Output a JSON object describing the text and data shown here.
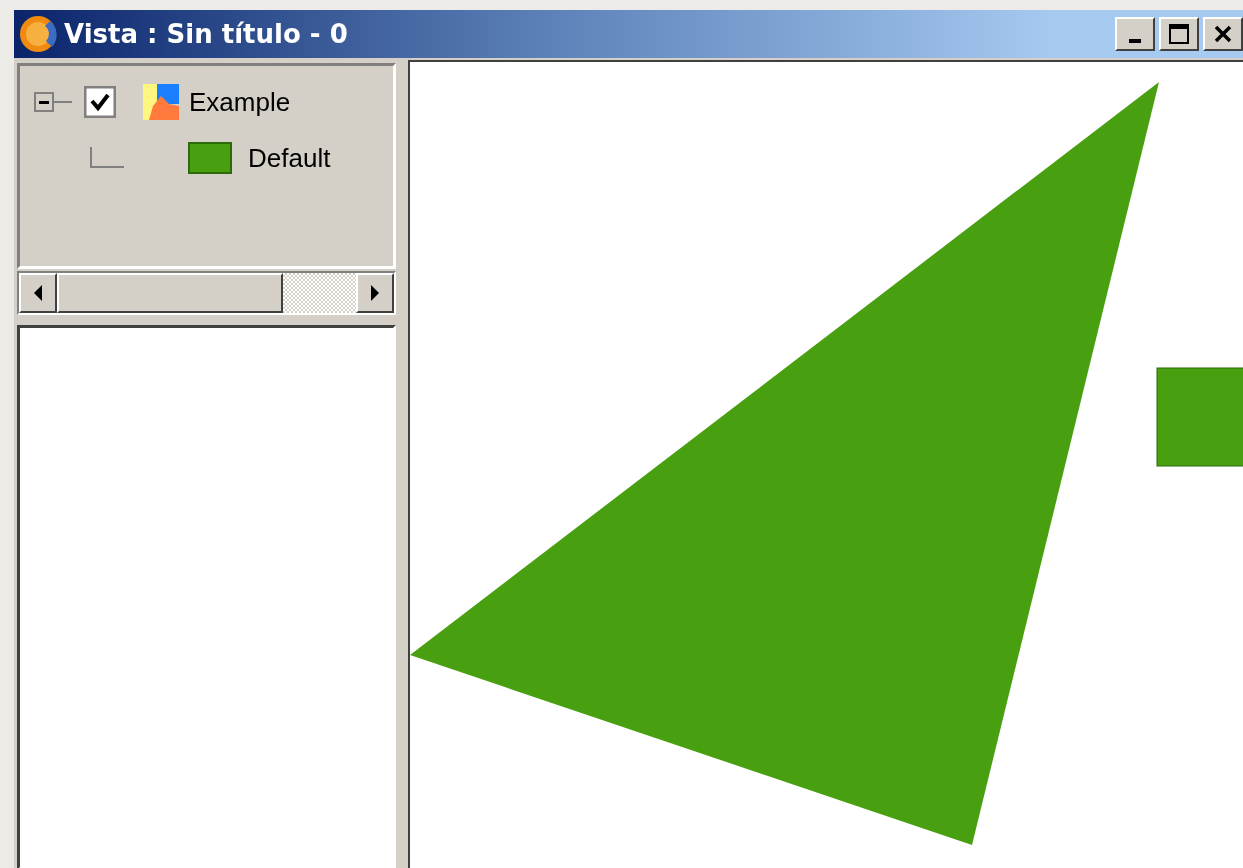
{
  "window": {
    "title": "Vista : Sin título - 0"
  },
  "toc": {
    "layers": [
      {
        "label": "Example",
        "checked": true,
        "expanded": true,
        "children": [
          {
            "label": "Default",
            "color": "#48a010"
          }
        ]
      }
    ]
  }
}
